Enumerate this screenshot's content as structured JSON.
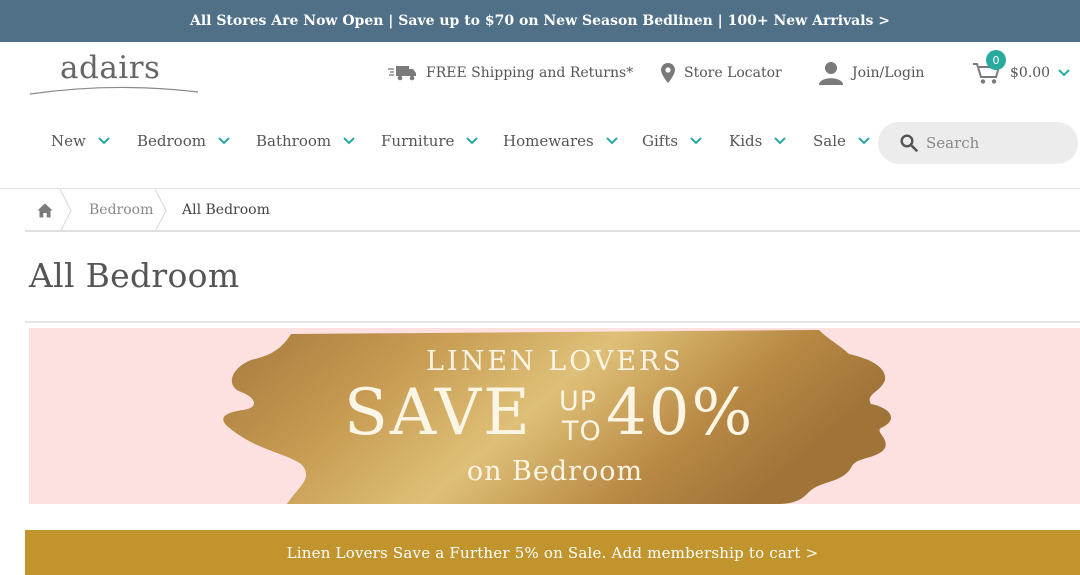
{
  "colors": {
    "promo_bg": "#4f7087",
    "accent": "#2aa99e",
    "banner_pink": "#fde1e1",
    "gold": "#c1942e"
  },
  "promo_bar": {
    "text": "All Stores Are Now Open | Save up to $70 on New Season Bedlinen | 100+ New Arrivals >"
  },
  "header": {
    "logo_text": "adairs",
    "shipping": {
      "icon": "truck-icon",
      "label": "FREE Shipping and Returns*"
    },
    "store_locator": {
      "icon": "map-pin-icon",
      "label": "Store Locator"
    },
    "login": {
      "icon": "user-icon",
      "label": "Join/Login"
    },
    "cart": {
      "icon": "cart-icon",
      "count": "0",
      "total": "$0.00"
    }
  },
  "nav": {
    "items": [
      {
        "label": "New"
      },
      {
        "label": "Bedroom"
      },
      {
        "label": "Bathroom"
      },
      {
        "label": "Furniture"
      },
      {
        "label": "Homewares"
      },
      {
        "label": "Gifts"
      },
      {
        "label": "Kids"
      },
      {
        "label": "Sale"
      }
    ],
    "search_placeholder": "Search"
  },
  "breadcrumb": {
    "home_icon": "home-icon",
    "items": [
      {
        "label": "Bedroom"
      },
      {
        "label": "All Bedroom"
      }
    ]
  },
  "page": {
    "title": "All Bedroom"
  },
  "banner": {
    "line1": "LINEN LOVERS",
    "save": "SAVE",
    "up": "UP",
    "to": "TO",
    "percent": "40%",
    "line3": "on Bedroom"
  },
  "member_bar": {
    "text": "Linen Lovers Save a Further 5% on Sale. Add membership to cart >"
  }
}
